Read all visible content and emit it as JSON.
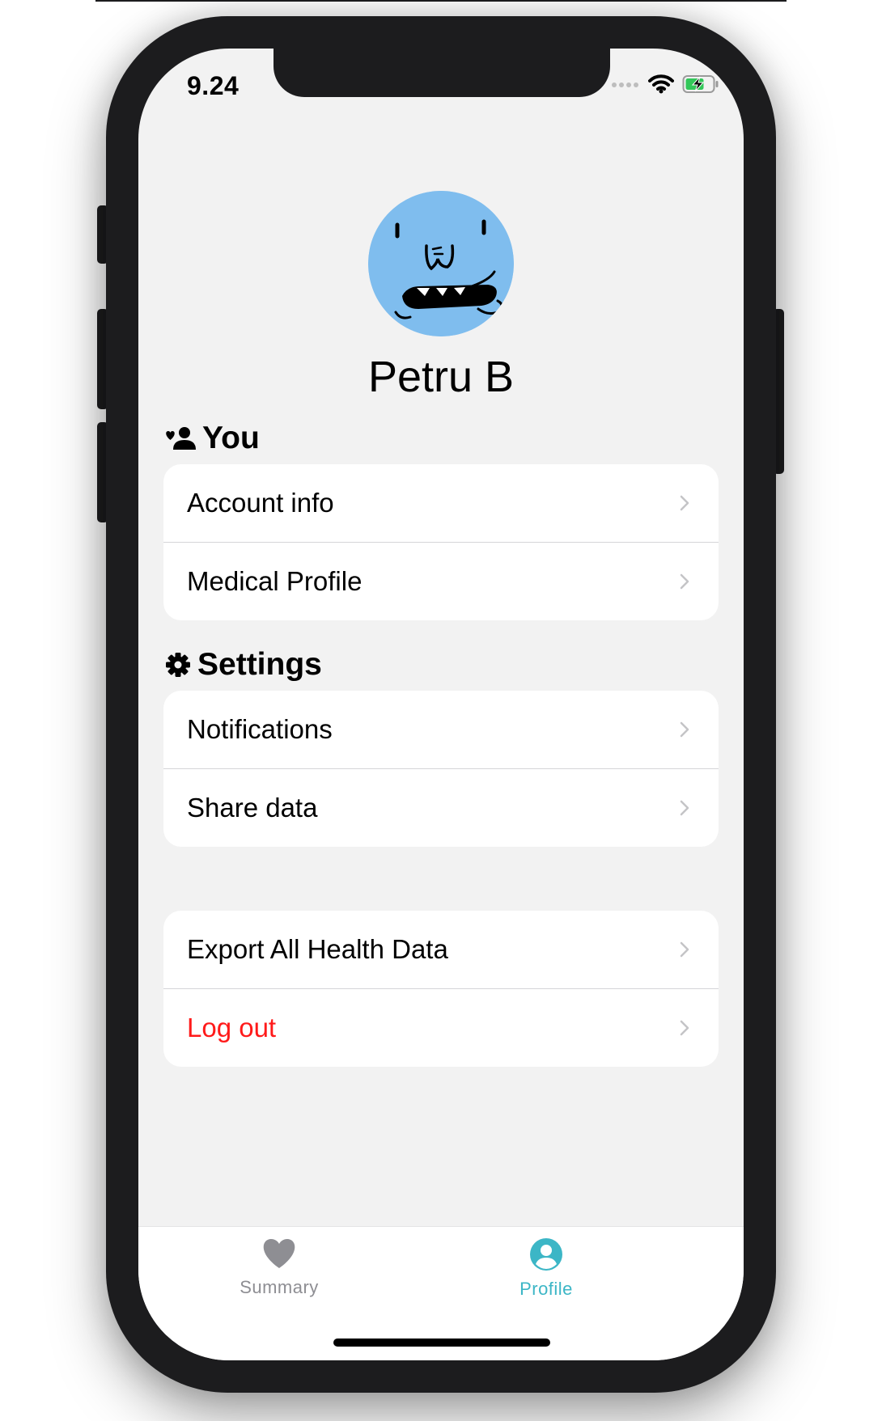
{
  "status_bar": {
    "time": "9.24"
  },
  "profile": {
    "name": "Petru B"
  },
  "sections": {
    "you": {
      "title": "You",
      "icon": "user-plus-icon",
      "items": [
        {
          "label": "Account info"
        },
        {
          "label": "Medical Profile"
        }
      ]
    },
    "settings": {
      "title": "Settings",
      "icon": "gear-icon",
      "items": [
        {
          "label": "Notifications"
        },
        {
          "label": "Share data"
        }
      ]
    },
    "actions": {
      "items": [
        {
          "label": "Export All Health Data"
        },
        {
          "label": "Log out"
        }
      ]
    }
  },
  "tabbar": {
    "tabs": [
      {
        "label": "Summary",
        "icon": "heart-icon",
        "active": false
      },
      {
        "label": "Profile",
        "icon": "user-circle-icon",
        "active": true
      }
    ]
  },
  "colors": {
    "accent": "#3cb6c6",
    "danger": "#ff1a1a",
    "inactive_tab": "#8e8e93",
    "avatar_background": "#7fbdee",
    "screen_background": "#f2f2f2"
  }
}
